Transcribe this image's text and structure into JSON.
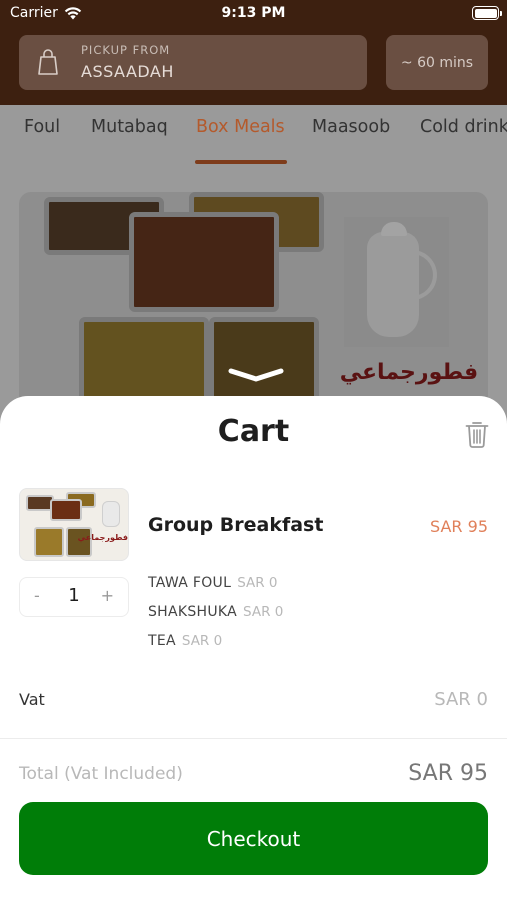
{
  "status_bar": {
    "carrier": "Carrier",
    "time": "9:13 PM"
  },
  "header": {
    "pickup_label": "PICKUP FROM",
    "pickup_location": "ASSAADAH",
    "eta": "~ 60 mins"
  },
  "tabs": [
    {
      "label": "Foul",
      "active": false
    },
    {
      "label": "Mutabaq",
      "active": false
    },
    {
      "label": "Box Meals",
      "active": true
    },
    {
      "label": "Maasoob",
      "active": false
    },
    {
      "label": "Cold drinks",
      "active": false
    }
  ],
  "banner": {
    "arabic_text": "فطورجماعي"
  },
  "cart": {
    "title": "Cart",
    "item": {
      "name": "Group Breakfast",
      "price": "SAR 95",
      "quantity": "1",
      "minus": "-",
      "plus": "+",
      "thumb_arabic": "فطورجماعي",
      "options": [
        {
          "name": "TAWA FOUL",
          "price": "SAR 0"
        },
        {
          "name": "SHAKSHUKA",
          "price": "SAR 0"
        },
        {
          "name": "TEA",
          "price": "SAR 0"
        }
      ]
    },
    "vat_label": "Vat",
    "vat_value": "SAR 0",
    "total_label": "Total",
    "total_note": "(Vat Included)",
    "total_value": "SAR 95",
    "checkout_label": "Checkout"
  },
  "colors": {
    "header_bg": "#3d2010",
    "accent": "#b45a2c",
    "price": "#e0805a",
    "checkout": "#007d08"
  }
}
